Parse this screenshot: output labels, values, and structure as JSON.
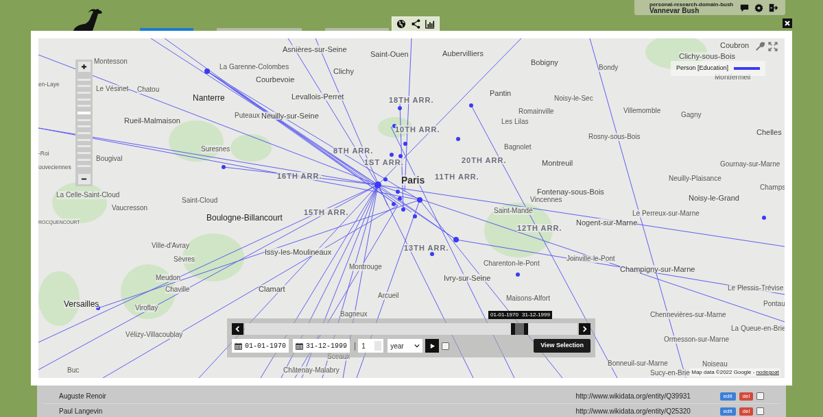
{
  "user_panel": {
    "domain": "personal-research-domain-bush",
    "user": "Vannevar Bush"
  },
  "header_tabs": [
    {
      "selected": true
    },
    {
      "selected": false
    },
    {
      "selected": false
    }
  ],
  "map": {
    "labels": [
      {
        "text": "Asnières-sur-Seine",
        "kind": "town"
      },
      {
        "text": "Saint-Ouen",
        "kind": "town"
      },
      {
        "text": "Aubervilliers",
        "kind": "town"
      },
      {
        "text": "Bobigny",
        "kind": "town"
      },
      {
        "text": "Bondy",
        "kind": "minor"
      },
      {
        "text": "Coubron",
        "kind": "town"
      },
      {
        "text": "Clichy-sous-Bois",
        "kind": "town"
      },
      {
        "text": "Montfermeil",
        "kind": "minor"
      },
      {
        "text": "Montesson",
        "kind": "minor"
      },
      {
        "text": "La Garenne-Colombes",
        "kind": "minor"
      },
      {
        "text": "Clichy",
        "kind": "town"
      },
      {
        "text": "Courbevoie",
        "kind": "town"
      },
      {
        "text": "Le Vésinet",
        "kind": "minor"
      },
      {
        "text": "Chatou",
        "kind": "minor"
      },
      {
        "text": "Levallois-Perret",
        "kind": "town"
      },
      {
        "text": "Pantin",
        "kind": "town"
      },
      {
        "text": "Noisy-le-Sec",
        "kind": "minor"
      },
      {
        "text": "en-Laye",
        "kind": "minor"
      },
      {
        "text": "Nanterre",
        "kind": "major"
      },
      {
        "text": "18TH ARR.",
        "kind": "district"
      },
      {
        "text": "Rueil-Malmaison",
        "kind": "town"
      },
      {
        "text": "Puteaux",
        "kind": "minor"
      },
      {
        "text": "Neuilly-sur-Seine",
        "kind": "town"
      },
      {
        "text": "Romainville",
        "kind": "minor"
      },
      {
        "text": "Villemomble",
        "kind": "minor"
      },
      {
        "text": "Gagny",
        "kind": "minor"
      },
      {
        "text": "Les Lilas",
        "kind": "minor"
      },
      {
        "text": "10TH ARR.",
        "kind": "district"
      },
      {
        "text": "Chelles",
        "kind": "town"
      },
      {
        "text": "Bagnolet",
        "kind": "minor"
      },
      {
        "text": "Rosny-sous-Bois",
        "kind": "minor"
      },
      {
        "text": "Suresnes",
        "kind": "minor"
      },
      {
        "text": "8TH ARR.",
        "kind": "district"
      },
      {
        "text": "Bougival",
        "kind": "minor"
      },
      {
        "text": "1ST ARR.",
        "kind": "district"
      },
      {
        "text": "20TH ARR.",
        "kind": "district"
      },
      {
        "text": "Montreuil",
        "kind": "town"
      },
      {
        "text": "Gournay-sur-Marne",
        "kind": "minor"
      },
      {
        "text": "-Roi",
        "kind": "minor"
      },
      {
        "text": "ouveciennes",
        "kind": "minor"
      },
      {
        "text": "Paris",
        "kind": "capital"
      },
      {
        "text": "16TH ARR.",
        "kind": "district"
      },
      {
        "text": "11TH ARR.",
        "kind": "district"
      },
      {
        "text": "Neuilly-Plaisance",
        "kind": "minor"
      },
      {
        "text": "Fontenay-sous-Bois",
        "kind": "town"
      },
      {
        "text": "Noisy-le-Grand",
        "kind": "town"
      },
      {
        "text": "Champs",
        "kind": "minor"
      },
      {
        "text": "La Celle-Saint-Cloud",
        "kind": "minor"
      },
      {
        "text": "Saint-Cloud",
        "kind": "minor"
      },
      {
        "text": "Vincennes",
        "kind": "minor"
      },
      {
        "text": "Vaucresson",
        "kind": "minor"
      },
      {
        "text": "Boulogne-Billancourt",
        "kind": "major"
      },
      {
        "text": "15TH ARR.",
        "kind": "district"
      },
      {
        "text": "Saint-Mandé",
        "kind": "minor"
      },
      {
        "text": "Le Perreux-sur-Marne",
        "kind": "minor"
      },
      {
        "text": "ROCQUENCOURT",
        "kind": "tiny"
      },
      {
        "text": "Nogent-sur-Marne",
        "kind": "town"
      },
      {
        "text": "12TH ARR.",
        "kind": "district"
      },
      {
        "text": "Ville-d'Avray",
        "kind": "minor"
      },
      {
        "text": "13TH ARR.",
        "kind": "district"
      },
      {
        "text": "Issy-les-Moulineaux",
        "kind": "town"
      },
      {
        "text": "Sèvres",
        "kind": "minor"
      },
      {
        "text": "Montrouge",
        "kind": "minor"
      },
      {
        "text": "Charenton-le-Pont",
        "kind": "minor"
      },
      {
        "text": "Joinville-le-Pont",
        "kind": "minor"
      },
      {
        "text": "Champigny-sur-Marne",
        "kind": "town"
      },
      {
        "text": "Meudon",
        "kind": "minor"
      },
      {
        "text": "Ivry-sur-Seine",
        "kind": "town"
      },
      {
        "text": "Chaville",
        "kind": "minor"
      },
      {
        "text": "Clamart",
        "kind": "town"
      },
      {
        "text": "Le Plessis-Trévise",
        "kind": "minor"
      },
      {
        "text": "Versailles",
        "kind": "major"
      },
      {
        "text": "Viroflay",
        "kind": "minor"
      },
      {
        "text": "Arcueil",
        "kind": "minor"
      },
      {
        "text": "Maisons-Alfort",
        "kind": "minor"
      },
      {
        "text": "Pontau",
        "kind": "minor"
      },
      {
        "text": "Bagneux",
        "kind": "minor"
      },
      {
        "text": "Chennevières-sur-Marne",
        "kind": "minor"
      },
      {
        "text": "Vélizy-Villacoublay",
        "kind": "minor"
      },
      {
        "text": "La Queue-en-Brie",
        "kind": "minor"
      },
      {
        "text": "Ormesson-sur-Marne",
        "kind": "minor"
      },
      {
        "text": "Sceaux",
        "kind": "minor"
      },
      {
        "text": "Buc",
        "kind": "minor"
      },
      {
        "text": "Châtenay-Malabry",
        "kind": "minor"
      },
      {
        "text": "Bonneuil-sur-Marne",
        "kind": "minor"
      },
      {
        "text": "Noiseau",
        "kind": "minor"
      },
      {
        "text": "Sucy-en-Brie",
        "kind": "minor"
      }
    ],
    "zoom": {
      "level": 0.62
    },
    "legend": [
      {
        "label": "Person [Education]",
        "color": "#3b3bf5"
      }
    ],
    "attribution": "Map data ©2022 Google - ",
    "attribution_link": "nodegoat"
  },
  "timeline": {
    "start_tooltip": "01-01-1970",
    "end_tooltip": "31-12-1999",
    "start_date": "01-01-1970",
    "end_date": "31-12-1999",
    "separator": "|",
    "step": "1",
    "unit": "year",
    "loop_checked": false,
    "view_button": "View Selection"
  },
  "records": [
    {
      "name": "Auguste Renoir",
      "url": "http://www.wikidata.org/entity/Q39931",
      "edit": "edit",
      "delete": "del",
      "checked": false
    },
    {
      "name": "Paul Langevin",
      "url": "http://www.wikidata.org/entity/Q25320",
      "edit": "edit",
      "delete": "del",
      "checked": false
    }
  ]
}
